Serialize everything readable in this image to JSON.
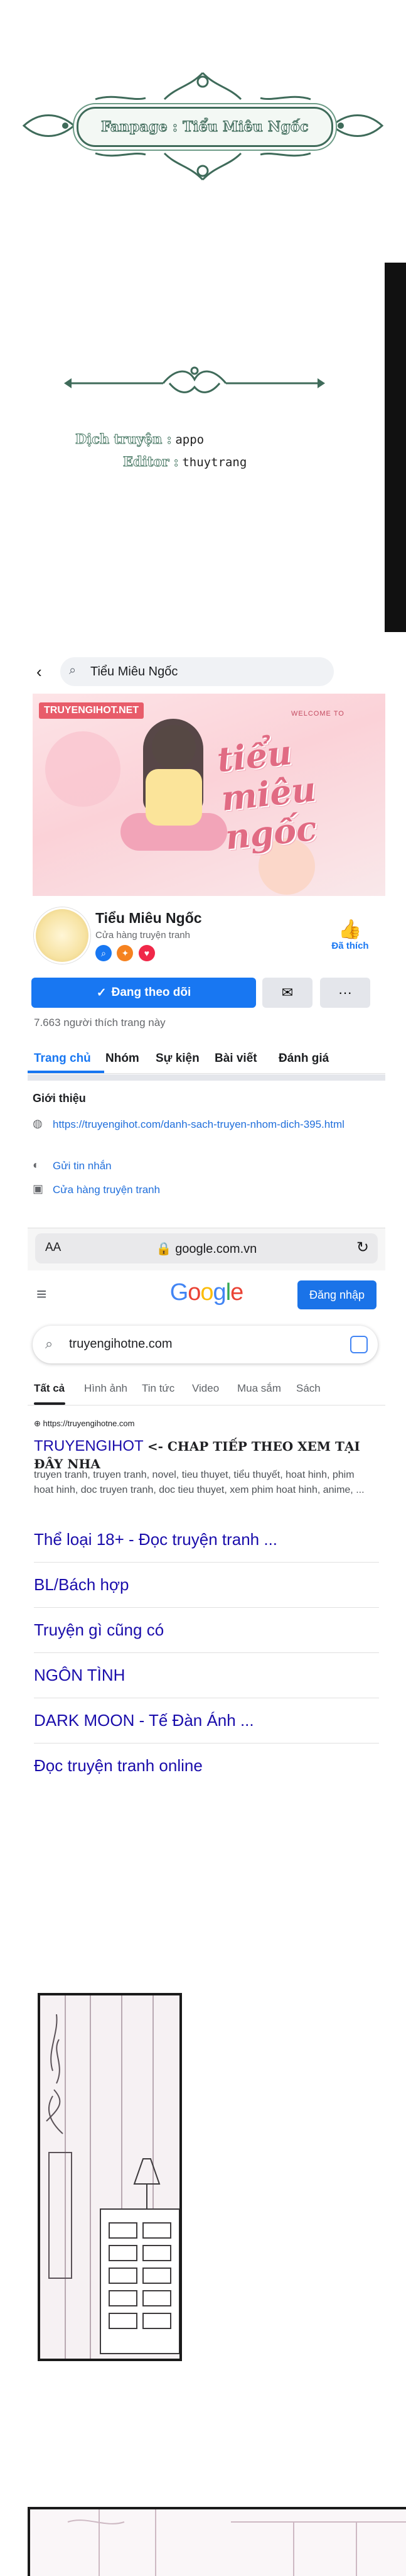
{
  "banner": {
    "fanpage_text": "Fanpage : Tiểu Miêu Ngốc"
  },
  "credits": {
    "translator_label": "Dịch truyện :",
    "translator_name": "appo",
    "editor_label": "Editor :",
    "editor_name": "thuytrang"
  },
  "facebook": {
    "search_text": "Tiểu Miêu Ngốc",
    "cover": {
      "site_tag": "TRUYENGIHOT.NET",
      "welcome": "WELCOME TO",
      "title": "tiểu miêu ngốc"
    },
    "page_name": "Tiểu Miêu Ngốc",
    "page_category": "Cửa hàng truyện tranh",
    "liked_label": "Đã thích",
    "follow_button": "Đang theo dõi",
    "messenger_icon": "messenger-icon",
    "more_label": "···",
    "likes_count": "7.663 người thích trang này",
    "tabs": [
      "Trang chủ",
      "Nhóm",
      "Sự kiện",
      "Bài viết",
      "Đánh giá"
    ],
    "intro_title": "Giới thiệu",
    "info": [
      {
        "icon": "globe-icon",
        "text": "https://truyengihot.com/danh-sach-truyen-nhom-dich-395.html"
      },
      {
        "icon": "messenger-icon",
        "text": "Gửi tin nhắn"
      },
      {
        "icon": "shop-icon",
        "text": "Cửa hàng truyện tranh"
      }
    ]
  },
  "safari": {
    "aa": "AA",
    "url": "google.com.vn"
  },
  "google": {
    "signin": "Đăng nhập",
    "query": "truyengihotne.com",
    "tabs": [
      "Tất cả",
      "Hình ảnh",
      "Tin tức",
      "Video",
      "Mua sắm",
      "Sách"
    ],
    "result": {
      "url": "https://truyengihotne.com",
      "title": "TRUYENGIHOT",
      "note": "<- CHAP TIẾP THEO XEM TẠI ĐÂY NHA",
      "snippet": "truyen tranh, truyen tranh, novel, tieu thuyet, tiểu thuyết, hoat hinh, phim hoat hinh, doc truyen tranh, doc tieu thuyet, xem phim hoat hinh, anime, ..."
    },
    "sublinks": [
      "Thể loại 18+ - Đọc truyện tranh ...",
      "BL/Bách hợp",
      "Truyện gì cũng có",
      "NGÔN TÌNH",
      "DARK MOON - Tế Đàn Ánh ...",
      "Đọc truyện tranh online"
    ]
  }
}
